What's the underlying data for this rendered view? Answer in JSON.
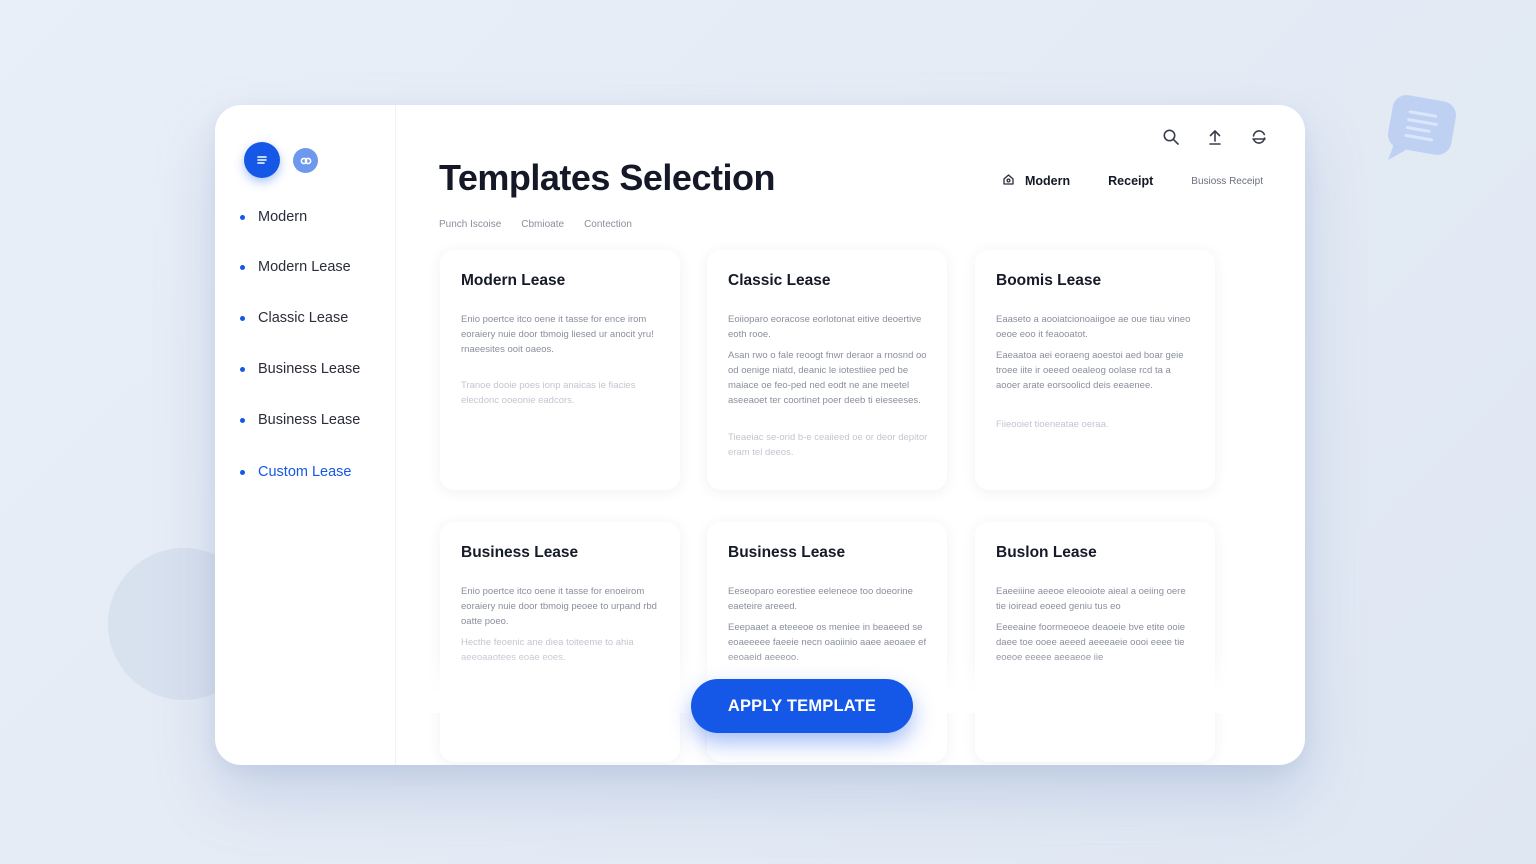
{
  "colors": {
    "accent": "#1558e8",
    "background": "#e6edf6",
    "card": "#ffffff"
  },
  "sidebar": {
    "brand_icon": "menu-lines-icon",
    "secondary_icon": "link-icon",
    "items": [
      {
        "label": "Modern",
        "active": false
      },
      {
        "label": "Modern Lease",
        "active": false
      },
      {
        "label": "Classic Lease",
        "active": false
      },
      {
        "label": "Business Lease",
        "active": false
      },
      {
        "label": "Business Lease",
        "active": false
      },
      {
        "label": "Custom Lease",
        "active": true
      }
    ]
  },
  "header": {
    "title": "Templates Selection",
    "icons": [
      "search-icon",
      "upload-icon",
      "sync-icon"
    ],
    "filters": [
      {
        "label": "Modern",
        "icon": "home-icon"
      },
      {
        "label": "Receipt"
      },
      {
        "label": "Busioss Receipt"
      }
    ],
    "subtabs": [
      "Punch Iscoise",
      "Cbmioate",
      "Contection"
    ]
  },
  "cards": [
    {
      "title": "Modern Lease",
      "paragraphs": [
        "Enio poertce itco oene it tasse for ence irom eoraiery nuie door tbmoig liesed ur anocit yru! rnaeesites ooit oaeos.",
        "Tranoe dooie poes ionp anaicas ie fiacies elecdonc ooeonie eadcors."
      ]
    },
    {
      "title": "Classic Lease",
      "paragraphs": [
        "Eoiioparo eoracose eorlotonat eitive deoertive eoth rooe.",
        "Asan rwo o fale reoogt fnwr deraor a rnosnd oo od oenige niatd, deanic le iotestiiee ped be maiace oe feo-ped ned eodt ne ane meetel aseeaoet ter coortinet poer deeb ti eieseeses.",
        "Tieaeiac se-orid b-e ceaiieed oe or deor depitor eram tel deeos."
      ]
    },
    {
      "title": "Boomis Lease",
      "paragraphs": [
        "Eaaseto a aooiatcionoaiigoe ae oue tiau vineo oeoe eoo it feaooatot.",
        "Eaeaatoa aei eoraeng aoestoi aed boar geie troee iite ir oeeed oealeog oolase rcd ta a aooer arate eorsoolicd deis eeaenee.",
        "Fiieooiet tioeneatae oeraa."
      ]
    },
    {
      "title": "Business Lease",
      "paragraphs": [
        "Enio poertce itco oene it tasse for enoeirom eoraiery nuie door tbmoig peoee to urpand rbd oatte poeo.",
        "Hecthe feoenic ane diea toiteeme to ahia aeeoaaotees eoae eoes."
      ]
    },
    {
      "title": "Business Lease",
      "paragraphs": [
        "Eeseoparo eorestiee eeleneoe too doeorine eaeteire areeed.",
        "Eeepaaet a eteeeoe os meniee in beaeeed se eoaeeeee faeeie necn oaoiinio aaee aeoaee ef eeoaeid aeeeoo."
      ]
    },
    {
      "title": "Buslon Lease",
      "paragraphs": [
        "Eaeeiiine aeeoe eleooiote aieal a oeiing oere tie ioiread eoeed geniu tus eo",
        "Eeeeaine foormeoeoe deaoeie bve etite ooie daee toe ooee aeeed aeeeaeie oooi eeee tie eoeoe eeeee aeeaeoe iie"
      ]
    }
  ],
  "apply_button": {
    "label": "APPLY TEMPLATE"
  }
}
